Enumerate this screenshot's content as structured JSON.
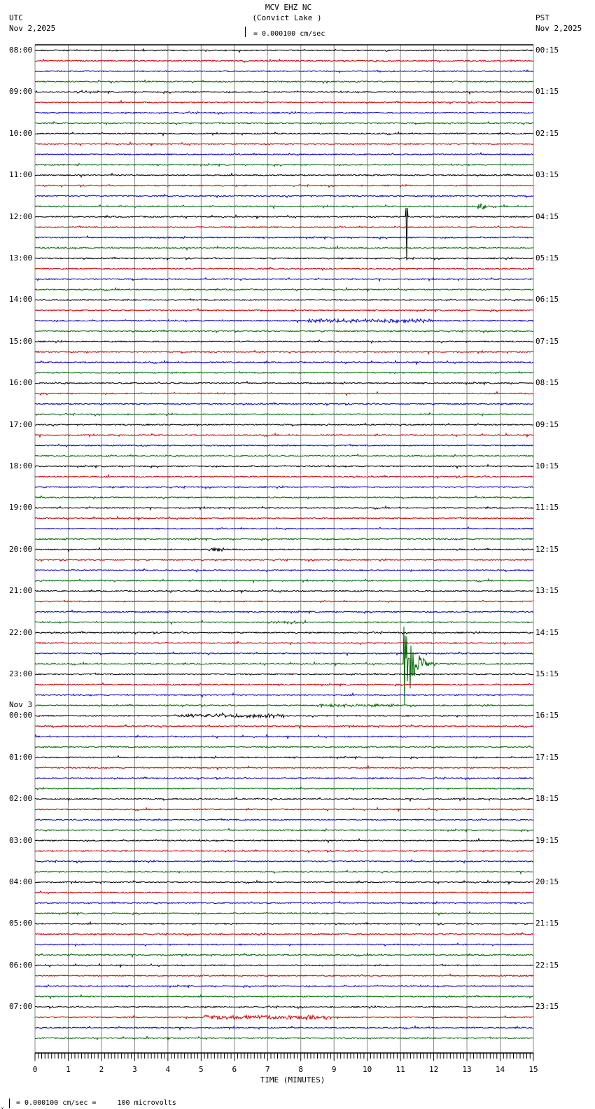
{
  "header": {
    "title": "MCV EHZ NC",
    "subtitle": "(Convict Lake )",
    "scale": "= 0.000100 cm/sec",
    "left_tz": "UTC",
    "left_date": "Nov 2,2025",
    "right_tz": "PST",
    "right_date": "Nov 2,2025"
  },
  "footer": {
    "scale_note": "= 0.000100 cm/sec =     100 microvolts",
    "marker": "x"
  },
  "chart_data": {
    "type": "line",
    "title": "MCV EHZ NC (Convict Lake )",
    "xlabel": "TIME (MINUTES)",
    "xlim": [
      0,
      15
    ],
    "x_ticks": [
      "0",
      "1",
      "2",
      "3",
      "4",
      "5",
      "6",
      "7",
      "8",
      "9",
      "10",
      "11",
      "12",
      "13",
      "14",
      "15"
    ],
    "trace_colors": [
      "#000000",
      "#cc0000",
      "#0000cc",
      "#006600"
    ],
    "traces_per_hour": 4,
    "trace_count": 96,
    "day_change_label": "Nov 3",
    "left_labels": [
      "08:00",
      "09:00",
      "10:00",
      "11:00",
      "12:00",
      "13:00",
      "14:00",
      "15:00",
      "16:00",
      "17:00",
      "18:00",
      "19:00",
      "20:00",
      "21:00",
      "22:00",
      "23:00",
      "00:00",
      "01:00",
      "02:00",
      "03:00",
      "04:00",
      "05:00",
      "06:00",
      "07:00"
    ],
    "right_labels": [
      "00:15",
      "01:15",
      "02:15",
      "03:15",
      "04:15",
      "05:15",
      "06:15",
      "07:15",
      "08:15",
      "09:15",
      "10:15",
      "11:15",
      "12:15",
      "13:15",
      "14:15",
      "15:15",
      "16:15",
      "17:15",
      "18:15",
      "19:15",
      "20:15",
      "21:15",
      "22:15",
      "23:15"
    ],
    "events": [
      {
        "trace": 16,
        "minute": 11.15,
        "amplitude": 4.2,
        "decay": 0.05,
        "type": "spike"
      },
      {
        "trace": 59,
        "minute": 11.1,
        "amplitude": 5.5,
        "decay": 0.6,
        "type": "quake"
      },
      {
        "trace": 26,
        "minute": 8.2,
        "amplitude": 0.3,
        "decay": 3.8,
        "type": "noise"
      },
      {
        "trace": 64,
        "minute": 4.2,
        "amplitude": 0.3,
        "decay": 3.3,
        "type": "noise"
      },
      {
        "trace": 93,
        "minute": 5.1,
        "amplitude": 0.35,
        "decay": 3.8,
        "type": "noise"
      },
      {
        "trace": 48,
        "minute": 5.2,
        "amplitude": 0.35,
        "decay": 0.5,
        "type": "noise"
      },
      {
        "trace": 55,
        "minute": 7.0,
        "amplitude": 0.25,
        "decay": 1.0,
        "type": "noise"
      },
      {
        "trace": 63,
        "minute": 8.5,
        "amplitude": 0.2,
        "decay": 2.5,
        "type": "noise"
      },
      {
        "trace": 15,
        "minute": 13.3,
        "amplitude": 0.5,
        "decay": 0.3,
        "type": "noise"
      }
    ]
  }
}
